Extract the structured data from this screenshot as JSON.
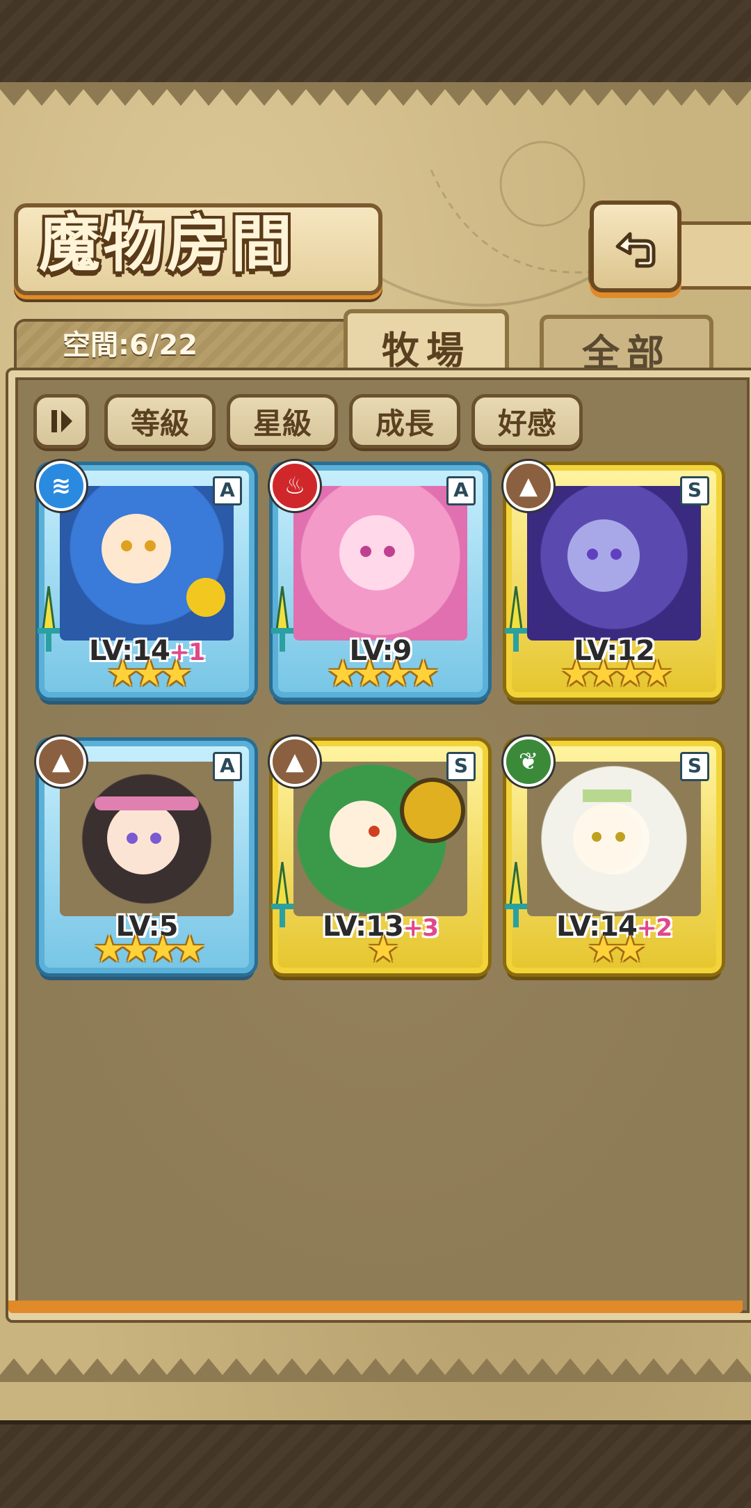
{
  "header": {
    "title": "魔物房間",
    "back_icon": "back-arrow-icon"
  },
  "space": {
    "label": "空間:6/22"
  },
  "tabs": [
    {
      "label": "牧場",
      "active": true
    },
    {
      "label": "全部",
      "active": false
    }
  ],
  "filters": {
    "pause_icon": "pause-icon",
    "buttons": [
      "等級",
      "星級",
      "成長",
      "好感"
    ]
  },
  "monsters": [
    {
      "level": "LV:14",
      "bonus": "+1",
      "stars": "★★★",
      "rank": "A",
      "element": "water",
      "frame": "blue"
    },
    {
      "level": "LV:9",
      "bonus": "",
      "stars": "★★★★",
      "rank": "A",
      "element": "fire",
      "frame": "blue"
    },
    {
      "level": "LV:12",
      "bonus": "",
      "stars": "★★★★",
      "rank": "S",
      "element": "earth",
      "frame": "gold"
    },
    {
      "level": "LV:5",
      "bonus": "",
      "stars": "★★★★",
      "rank": "A",
      "element": "earth",
      "frame": "blue"
    },
    {
      "level": "LV:13",
      "bonus": "+3",
      "stars": "★",
      "rank": "S",
      "element": "earth",
      "frame": "gold"
    },
    {
      "level": "LV:14",
      "bonus": "+2",
      "stars": "★★",
      "rank": "S",
      "element": "wind",
      "frame": "gold"
    }
  ],
  "colors": {
    "parchment": "#c9b37e",
    "panel": "#8e7c57",
    "accent_orange": "#e08a2a",
    "bonus_pink": "#e0488a"
  }
}
